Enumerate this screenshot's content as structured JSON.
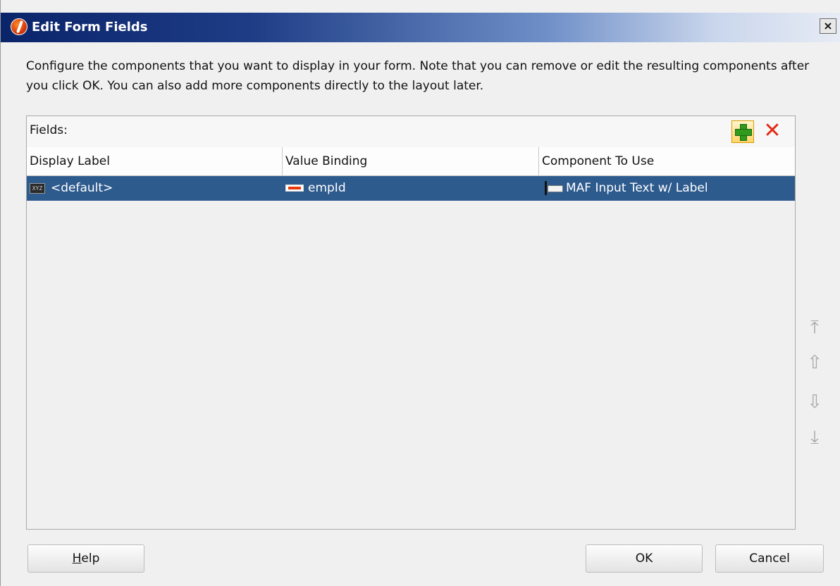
{
  "window": {
    "title": "Edit Form Fields",
    "close_glyph": "×"
  },
  "description": "Configure the components that you want to display in your form.  Note that you can remove or edit the resulting components after you click OK.  You can also add more components directly to the layout later.",
  "fields": {
    "label": "Fields:",
    "add_icon": "green-plus-icon",
    "remove_icon": "red-x-icon",
    "remove_glyph": "✕",
    "columns": [
      "Display Label",
      "Value Binding",
      "Component To Use"
    ],
    "rows": [
      {
        "display_label": "<default>",
        "value_binding": "empId",
        "component": "MAF Input Text w/ Label",
        "selected": true,
        "display_icon": "xyz",
        "display_icon_text": "XYZ"
      }
    ]
  },
  "side_arrows": [
    {
      "name": "move-top",
      "glyph": "⤒"
    },
    {
      "name": "move-up",
      "glyph": "⇧"
    },
    {
      "name": "move-down",
      "glyph": "⇩"
    },
    {
      "name": "move-bottom",
      "glyph": "⤓"
    }
  ],
  "buttons": {
    "help_mnemonic": "H",
    "help_rest": "elp",
    "ok": "OK",
    "cancel": "Cancel"
  },
  "colors": {
    "selection": "#2e5b8e",
    "titlebar_start": "#0a246a",
    "remove": "#e32a14",
    "add": "#2f9a1e"
  }
}
